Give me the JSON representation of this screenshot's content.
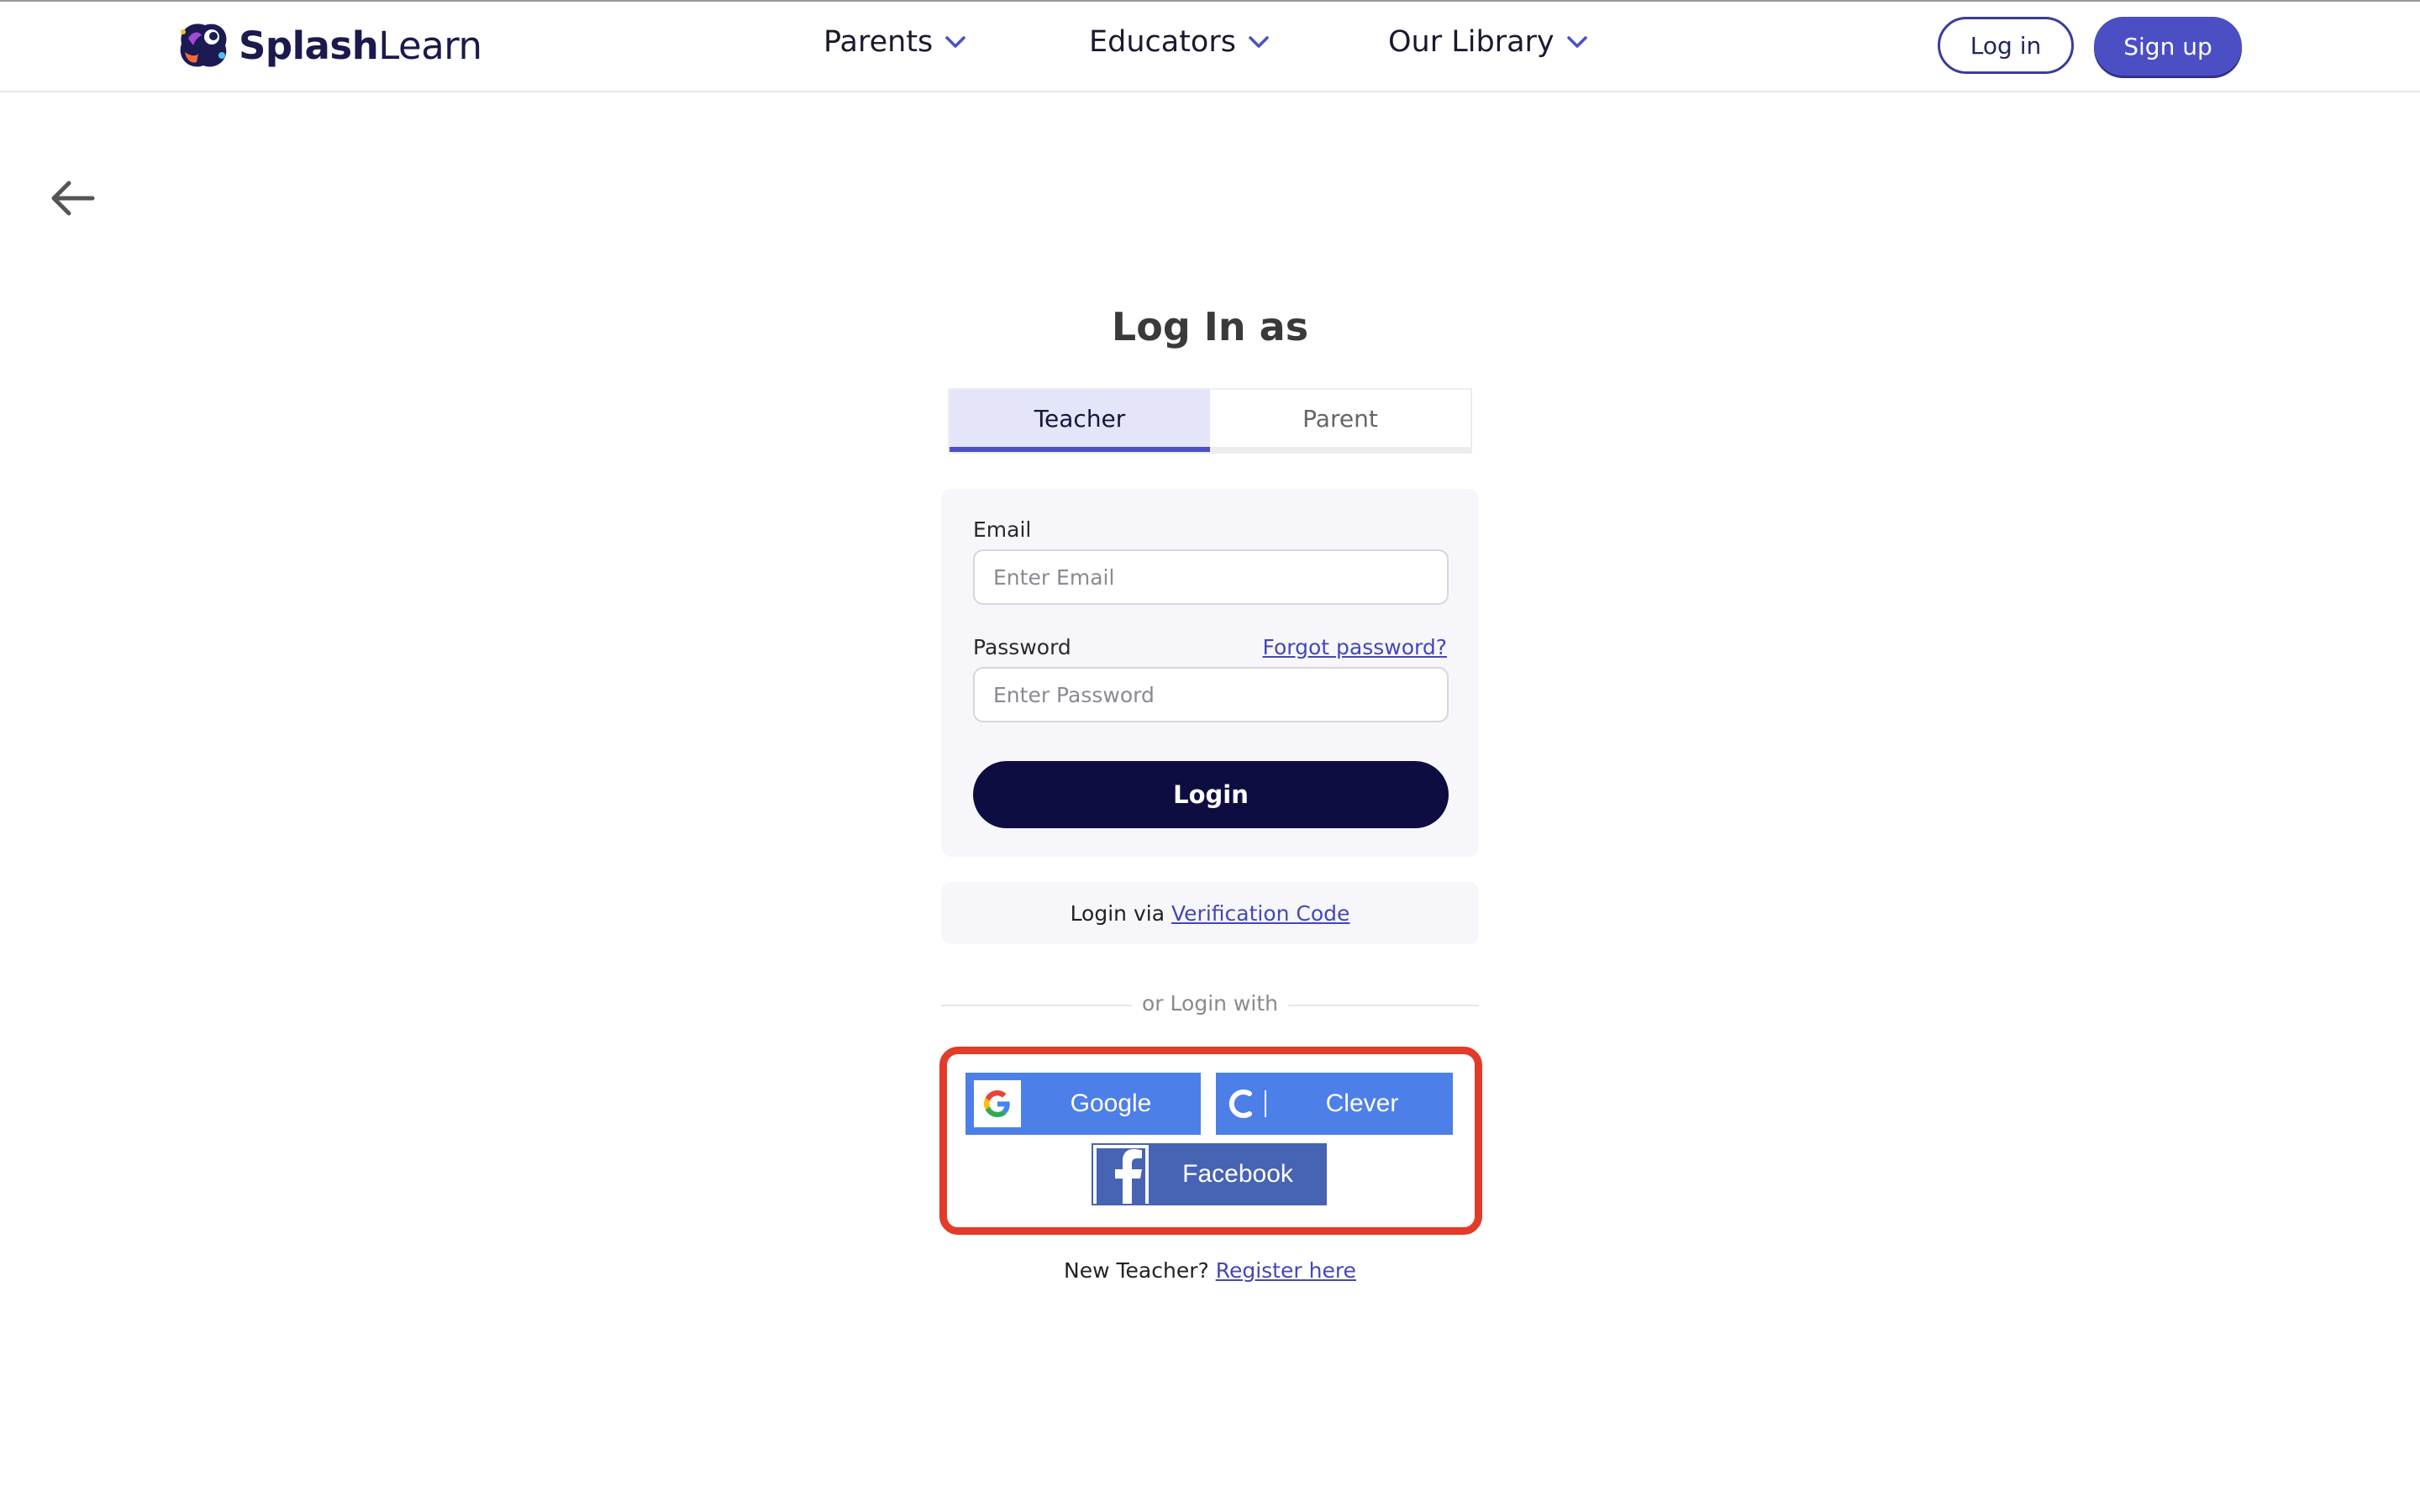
{
  "header": {
    "logo": {
      "bold": "Splash",
      "regular": "Learn"
    },
    "nav": [
      {
        "label": "Parents"
      },
      {
        "label": "Educators"
      },
      {
        "label": "Our Library"
      }
    ],
    "login_label": "Log in",
    "signup_label": "Sign up"
  },
  "page": {
    "title": "Log In as",
    "tabs": [
      {
        "label": "Teacher",
        "active": true
      },
      {
        "label": "Parent",
        "active": false
      }
    ]
  },
  "form": {
    "email_label": "Email",
    "email_placeholder": "Enter Email",
    "password_label": "Password",
    "forgot_label": "Forgot password?",
    "password_placeholder": "Enter Password",
    "login_button": "Login"
  },
  "verification": {
    "prefix": "Login via",
    "link": "Verification Code"
  },
  "divider": {
    "text": "or Login with"
  },
  "social": {
    "google": "Google",
    "clever": "Clever",
    "facebook": "Facebook"
  },
  "register": {
    "prefix": "New Teacher?",
    "link": "Register here"
  },
  "colors": {
    "brand_primary": "#4c4fc4",
    "login_button": "#0e0d42",
    "google_clever": "#4d7fe8",
    "facebook": "#4763b3",
    "highlight_box": "#e23b28"
  }
}
